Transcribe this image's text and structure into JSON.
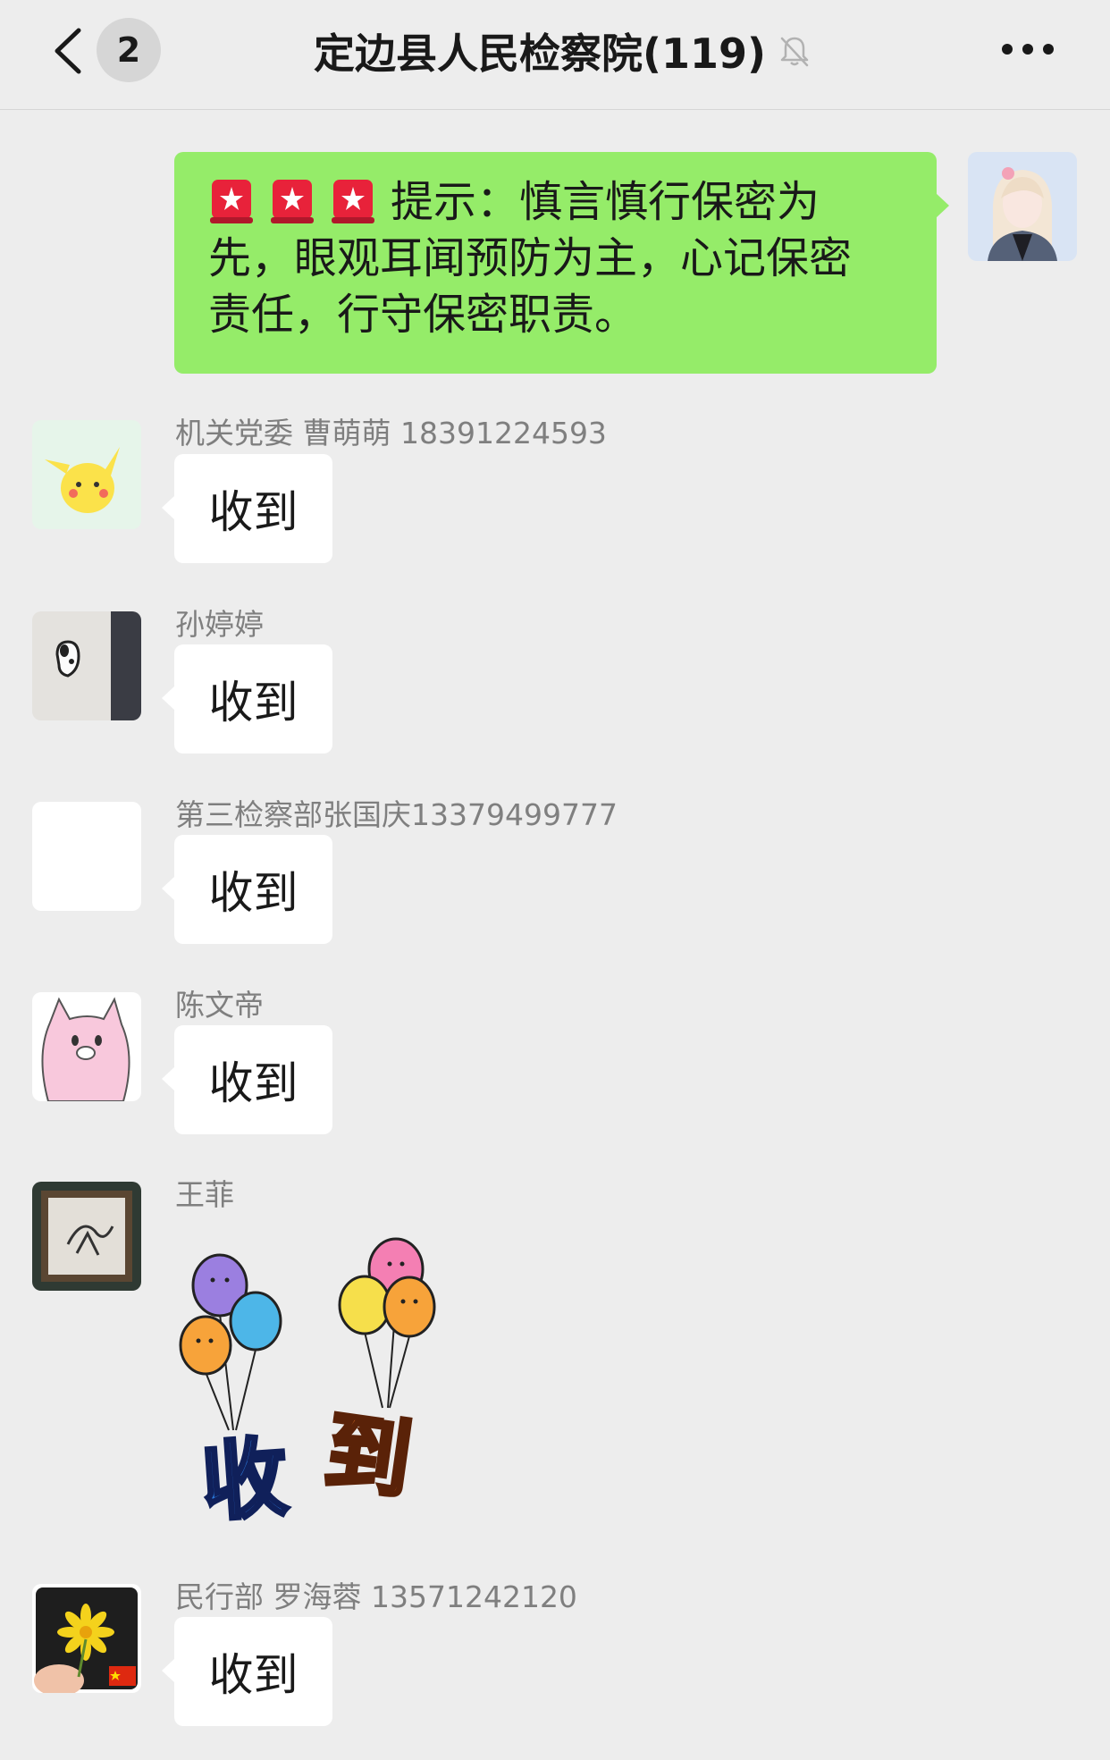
{
  "header": {
    "unread_count": "2",
    "title": "定边县人民检察院(119)",
    "back_icon": "chevron-left-icon",
    "mute_icon": "bell-slash-icon",
    "more_icon": "ellipsis-icon"
  },
  "notice": {
    "icon": "rotating-light-icon",
    "lines": [
      "提示：慎言慎行保密为",
      "先，眼观耳闻预防为主，心记保密",
      "责任，行守保密职责。"
    ]
  },
  "messages": [
    {
      "sender": "机关党委   曹萌萌  18391224593",
      "text": "收到"
    },
    {
      "sender": "孙婷婷",
      "text": "收到"
    },
    {
      "sender": "第三检察部张国庆13379499777",
      "text": "收到"
    },
    {
      "sender": "陈文帝",
      "text": "收到"
    },
    {
      "sender": "王菲",
      "sticker_text": [
        "收",
        "到"
      ]
    },
    {
      "sender": "民行部 罗海蓉 13571242120",
      "text": "收到"
    }
  ],
  "colors": {
    "background": "#ededed",
    "my_bubble": "#95ec69",
    "other_bubble": "#ffffff",
    "name_text": "#7f7f7f"
  }
}
